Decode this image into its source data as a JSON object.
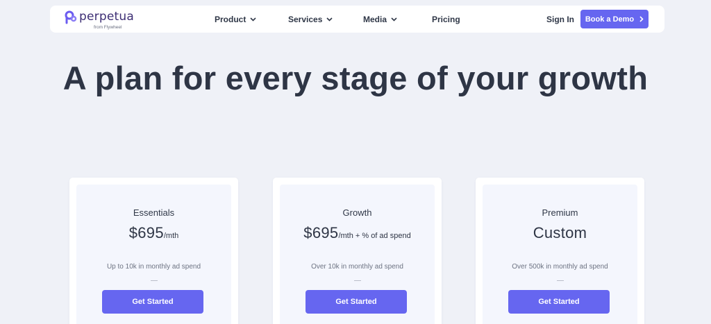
{
  "brand": {
    "name": "perpetua",
    "tagline": "from Flywheel",
    "accent_color": "#6666f0"
  },
  "nav": {
    "items": [
      {
        "label": "Product",
        "has_dropdown": true
      },
      {
        "label": "Services",
        "has_dropdown": true
      },
      {
        "label": "Media",
        "has_dropdown": true
      },
      {
        "label": "Pricing",
        "has_dropdown": false
      }
    ],
    "sign_in": "Sign In",
    "demo_button": "Book a Demo"
  },
  "hero": {
    "title": "A plan for every stage of your growth"
  },
  "plans": [
    {
      "name": "Essentials",
      "price": "$695",
      "price_suffix": "/mth",
      "spend": "Up to 10k in monthly ad spend",
      "cta": "Get Started"
    },
    {
      "name": "Growth",
      "price": "$695",
      "price_suffix": "/mth + % of ad spend",
      "spend": "Over 10k in monthly ad spend",
      "cta": "Get Started"
    },
    {
      "name": "Premium",
      "price": "Custom",
      "price_suffix": "",
      "spend": "Over 500k in monthly ad spend",
      "cta": "Get Started"
    }
  ]
}
